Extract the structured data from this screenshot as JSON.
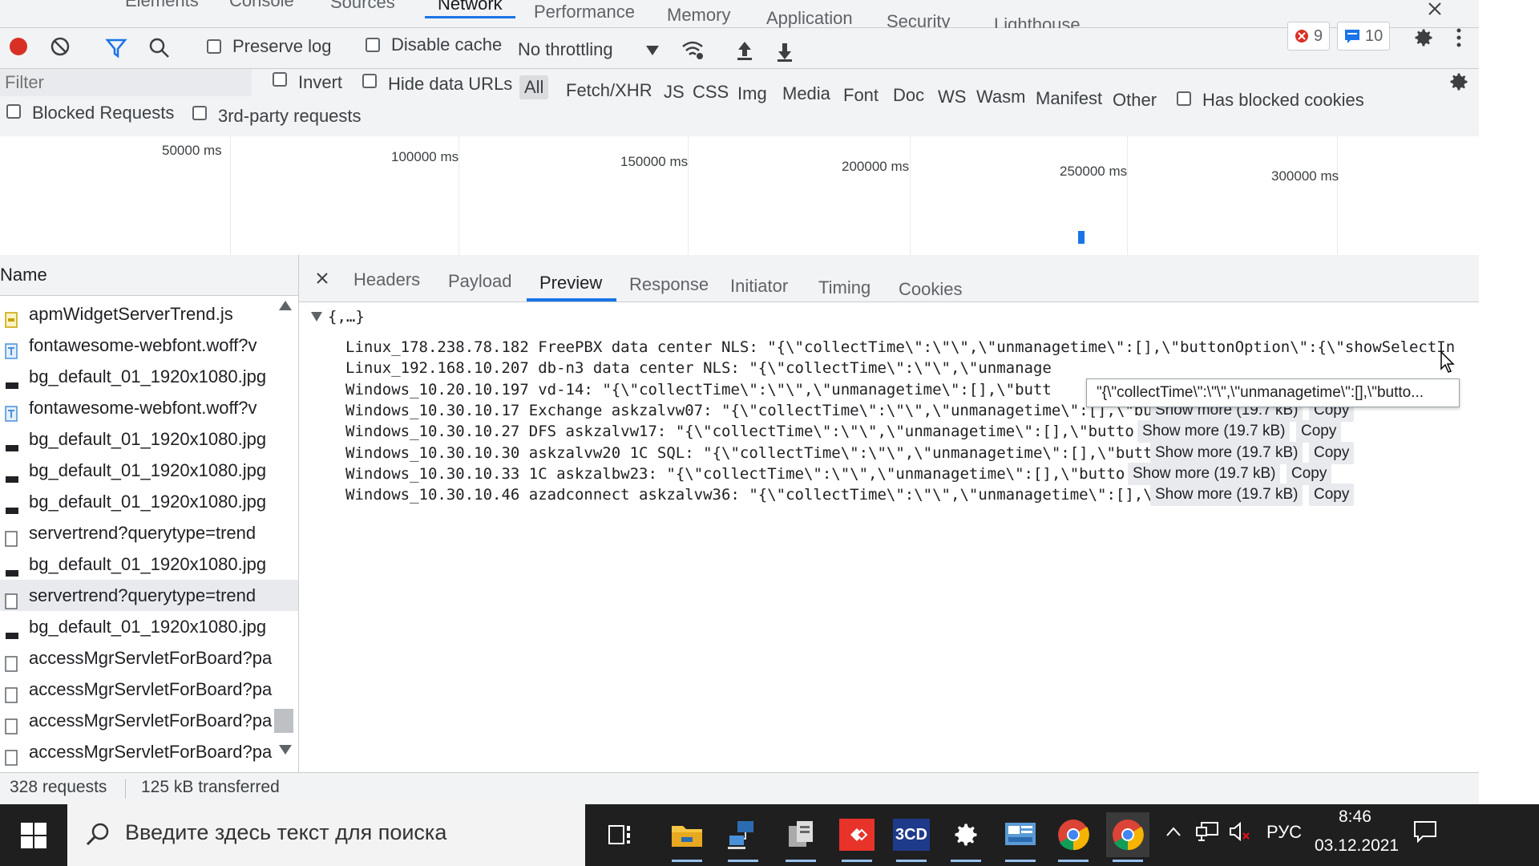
{
  "colors": {
    "accent": "#1a73e8",
    "record": "#d93025",
    "taskbar": "#1f1f1f"
  },
  "devtools_tabs": [
    "Elements",
    "Console",
    "Sources",
    "Network",
    "Performance",
    "Memory",
    "Application",
    "Security",
    "Lighthouse"
  ],
  "active_devtools_tab": "Network",
  "toolbar": {
    "preserve_log": "Preserve log",
    "disable_cache": "Disable cache",
    "throttling": "No throttling",
    "errors_count": "9",
    "messages_count": "10"
  },
  "filter_bar": {
    "placeholder": "Filter",
    "invert": "Invert",
    "hide_data_urls": "Hide data URLs",
    "types": [
      "All",
      "Fetch/XHR",
      "JS",
      "CSS",
      "Img",
      "Media",
      "Font",
      "Doc",
      "WS",
      "Wasm",
      "Manifest",
      "Other"
    ],
    "selected_type": "All",
    "has_blocked_cookies": "Has blocked cookies",
    "blocked_requests": "Blocked Requests",
    "third_party": "3rd-party requests"
  },
  "overview": {
    "ticks": [
      "50000 ms",
      "100000 ms",
      "150000 ms",
      "200000 ms",
      "250000 ms",
      "300000 ms"
    ]
  },
  "requests": {
    "header": "Name",
    "items": [
      {
        "name": "apmWidgetServerTrend.js",
        "icon": "js-file-icon"
      },
      {
        "name": "fontawesome-webfont.woff?v",
        "icon": "font-file-icon"
      },
      {
        "name": "bg_default_01_1920x1080.jpg",
        "icon": "image-file-icon"
      },
      {
        "name": "fontawesome-webfont.woff?v",
        "icon": "font-file-icon"
      },
      {
        "name": "bg_default_01_1920x1080.jpg",
        "icon": "image-file-icon"
      },
      {
        "name": "bg_default_01_1920x1080.jpg",
        "icon": "image-file-icon"
      },
      {
        "name": "bg_default_01_1920x1080.jpg",
        "icon": "image-file-icon"
      },
      {
        "name": "servertrend?querytype=trend",
        "icon": "xhr-file-icon"
      },
      {
        "name": "bg_default_01_1920x1080.jpg",
        "icon": "image-file-icon"
      },
      {
        "name": "servertrend?querytype=trend",
        "icon": "xhr-file-icon"
      },
      {
        "name": "bg_default_01_1920x1080.jpg",
        "icon": "image-file-icon"
      },
      {
        "name": "accessMgrServletForBoard?pa",
        "icon": "xhr-file-icon"
      },
      {
        "name": "accessMgrServletForBoard?pa",
        "icon": "xhr-file-icon"
      },
      {
        "name": "accessMgrServletForBoard?pa",
        "icon": "xhr-file-icon"
      },
      {
        "name": "accessMgrServletForBoard?pa",
        "icon": "xhr-file-icon"
      }
    ]
  },
  "detail_tabs": [
    "Headers",
    "Payload",
    "Preview",
    "Response",
    "Initiator",
    "Timing",
    "Cookies"
  ],
  "active_detail_tab": "Preview",
  "preview": {
    "root": "{,…}",
    "lines": [
      {
        "key": "Linux_178.238.78.182 FreePBX data center NLS:",
        "value": "\"{\\\"collectTime\\\":\\\"\\\",\\\"unmanagetime\\\":[],\\\"buttonOption\\\":{\\\"showSelectIn",
        "show_more": "",
        "copy": ""
      },
      {
        "key": "Linux_192.168.10.207 db-n3 data center NLS:",
        "value": "\"{\\\"collectTime\\\":\\\"\\\",\\\"unmanage",
        "show_more": "",
        "copy": ""
      },
      {
        "key": "Windows_10.20.10.197 vd-14:",
        "value": "\"{\\\"collectTime\\\":\\\"\\\",\\\"unmanagetime\\\":[],\\\"butt",
        "show_more": "",
        "copy": ""
      },
      {
        "key": "Windows_10.30.10.17 Exchange askzalvw07:",
        "value": "\"{\\\"collectTime\\\":\\\"\\\",\\\"unmanagetime\\\":[],\\\"butto",
        "show_more": "Show more (19.7 kB)",
        "copy": "Copy"
      },
      {
        "key": "Windows_10.30.10.27 DFS askzalvw17:",
        "value": "\"{\\\"collectTime\\\":\\\"\\\",\\\"unmanagetime\\\":[],\\\"butto",
        "show_more": "Show more (19.7 kB)",
        "copy": "Copy"
      },
      {
        "key": "Windows_10.30.10.30 askzalvw20 1C SQL:",
        "value": "\"{\\\"collectTime\\\":\\\"\\\",\\\"unmanagetime\\\":[],\\\"butto",
        "show_more": "Show more (19.7 kB)",
        "copy": "Copy"
      },
      {
        "key": "Windows_10.30.10.33 1C askzalbw23:",
        "value": "\"{\\\"collectTime\\\":\\\"\\\",\\\"unmanagetime\\\":[],\\\"butto",
        "show_more": "Show more (19.7 kB)",
        "copy": "Copy"
      },
      {
        "key": "Windows_10.30.10.46 azadconnect askzalvw36:",
        "value": "\"{\\\"collectTime\\\":\\\"\\\",\\\"unmanagetime\\\":[],\\\"butto",
        "show_more": "Show more (19.7 kB)",
        "copy": "Copy"
      }
    ],
    "tooltip": "\"{\\\"collectTime\\\":\\\"\\\",\\\"unmanagetime\\\":[],\\\"butto..."
  },
  "status": {
    "requests": "328 requests",
    "transferred": "125 kB transferred"
  },
  "taskbar": {
    "search_placeholder": "Введите здесь текст для поиска",
    "language": "РУС",
    "time": "8:46",
    "date": "03.12.2021",
    "apps": [
      "task-view-icon",
      "file-explorer-icon",
      "network-app-icon",
      "server-app-icon",
      "anydesk-icon",
      "3cd-app-icon",
      "settings-icon",
      "control-panel-icon",
      "chrome-icon",
      "chrome-icon"
    ],
    "app_labels": {
      "threecd": "3CD"
    }
  }
}
